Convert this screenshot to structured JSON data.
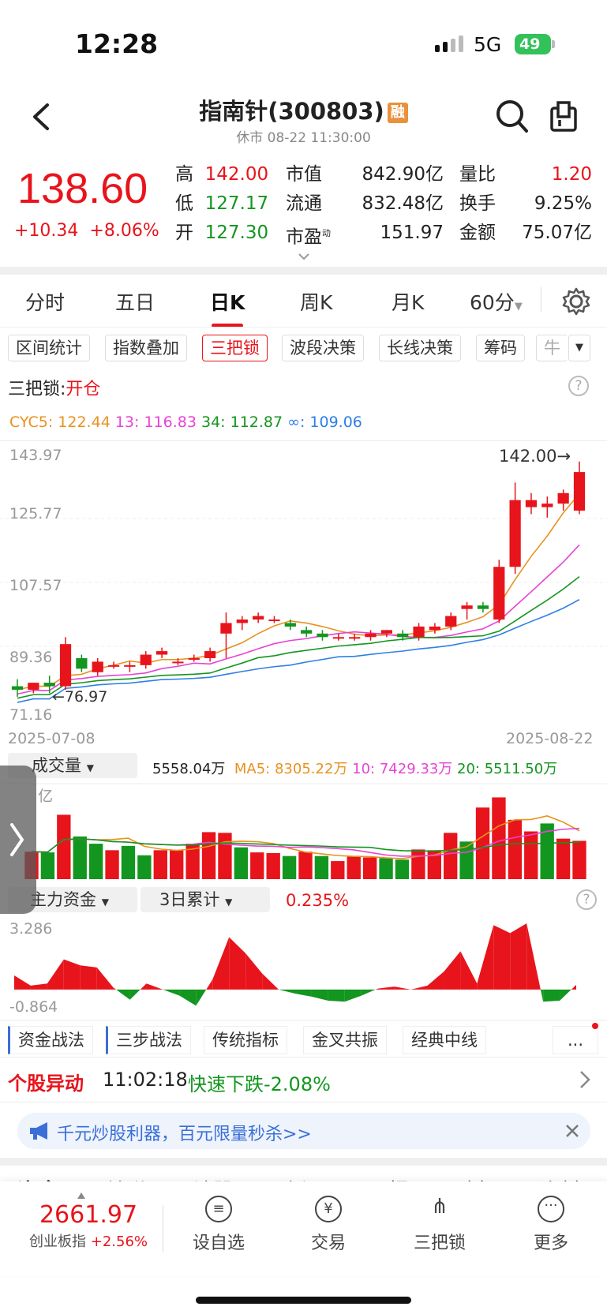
{
  "status_bar": {
    "time": "12:28",
    "network": "5G",
    "battery": "49"
  },
  "header": {
    "title": "指南针(300803)",
    "badge": "融",
    "subtitle": "休市 08-22 11:30:00"
  },
  "quote": {
    "price": "138.60",
    "change": "+10.34",
    "change_pct": "+8.06%",
    "grid": [
      {
        "label": "高",
        "value": "142.00",
        "color": "red"
      },
      {
        "label": "低",
        "value": "127.17",
        "color": "green"
      },
      {
        "label": "开",
        "value": "127.30",
        "color": "green"
      },
      {
        "label": "市值",
        "value": "842.90亿"
      },
      {
        "label": "流通",
        "value": "832.48亿"
      },
      {
        "label": "市盈",
        "sup": "动",
        "value": "151.97"
      },
      {
        "label": "量比",
        "value": "1.20",
        "color": "red"
      },
      {
        "label": "换手",
        "value": "9.25%"
      },
      {
        "label": "金额",
        "value": "75.07亿"
      }
    ]
  },
  "tabs": [
    "分时",
    "五日",
    "日K",
    "周K",
    "月K",
    "60分"
  ],
  "active_tab": "日K",
  "chips": [
    "区间统计",
    "指数叠加",
    "三把锁",
    "波段决策",
    "长线决策",
    "筹码",
    "牛"
  ],
  "selected_chip": "三把锁",
  "signal": {
    "label": "三把锁:",
    "value": "开仓"
  },
  "ma_legend": [
    {
      "text": "CYC5: 122.44",
      "color": "#e8921f"
    },
    {
      "text": "13: 116.83",
      "color": "#e843d4"
    },
    {
      "text": "34: 112.87",
      "color": "#13961f"
    },
    {
      "text": "∞: 109.06",
      "color": "#2f7fe6"
    }
  ],
  "price_axis": [
    "143.97",
    "125.77",
    "107.57",
    "89.36",
    "71.16"
  ],
  "annotations": {
    "high": "142.00→",
    "low": "←76.97"
  },
  "dates": {
    "start": "2025-07-08",
    "end": "2025-08-22"
  },
  "volume": {
    "selector": "成交量",
    "value": "5558.04万",
    "ma5": "MA5: 8305.22万",
    "ma10": "10: 7429.33万",
    "ma20": "20: 5511.50万",
    "axis": "亿"
  },
  "capital": {
    "selector": "主力资金",
    "period": "3日累计",
    "value": "0.235%",
    "max": "3.286",
    "min": "-0.864"
  },
  "bottom_tabs": [
    "资金战法",
    "三步战法",
    "传统指标",
    "金叉共振",
    "经典中线",
    "..."
  ],
  "alert": {
    "title": "个股异动",
    "time": "11:02:18",
    "text": "快速下跌-2.08%"
  },
  "banner": {
    "text": "千元炒股利器，百元限量秒杀>>"
  },
  "section_tabs": [
    "资金",
    "关联",
    "诊股",
    "资讯",
    "研报",
    "财务",
    "资料"
  ],
  "nav": {
    "index_value": "2661.97",
    "index_name": "创业板指",
    "index_change": "+2.56%",
    "items": [
      {
        "label": "设自选",
        "icon": "menu-icon"
      },
      {
        "label": "交易",
        "icon": "yen-icon"
      },
      {
        "label": "三把锁",
        "icon": "lock-tree-icon"
      },
      {
        "label": "更多",
        "icon": "more-icon"
      }
    ]
  },
  "chart_data": [
    {
      "type": "candlestick",
      "title": "日K",
      "ylim": [
        71.16,
        143.97
      ],
      "x_range": [
        "2025-07-08",
        "2025-08-22"
      ],
      "ohlc": [
        [
          78,
          80,
          75,
          77
        ],
        [
          77,
          79,
          76,
          79
        ],
        [
          79,
          81,
          76,
          78
        ],
        [
          78,
          92,
          77,
          90
        ],
        [
          86,
          87,
          82,
          83
        ],
        [
          82,
          86,
          81,
          85
        ],
        [
          84,
          85,
          83,
          84
        ],
        [
          84,
          85,
          82,
          84
        ],
        [
          84,
          88,
          83,
          87
        ],
        [
          87,
          89,
          86,
          88
        ],
        [
          85,
          86,
          84,
          85
        ],
        [
          86,
          87,
          85,
          86
        ],
        [
          86,
          89,
          85,
          88
        ],
        [
          93,
          99,
          86,
          96
        ],
        [
          96,
          98,
          94,
          97
        ],
        [
          97,
          99,
          96,
          98
        ],
        [
          97,
          98,
          96,
          97
        ],
        [
          96,
          97,
          94,
          95
        ],
        [
          94,
          95,
          92,
          93
        ],
        [
          93,
          94,
          91,
          92
        ],
        [
          92,
          93,
          91,
          92
        ],
        [
          92,
          93,
          91,
          92
        ],
        [
          92,
          94,
          91,
          93
        ],
        [
          93,
          94,
          92,
          94
        ],
        [
          93,
          94,
          91,
          92
        ],
        [
          92,
          96,
          91,
          95
        ],
        [
          94,
          96,
          93,
          95
        ],
        [
          95,
          99,
          94,
          98
        ],
        [
          100,
          102,
          97,
          101
        ],
        [
          101,
          102,
          99,
          100
        ],
        [
          97,
          114,
          96,
          112
        ],
        [
          112,
          136,
          110,
          131
        ],
        [
          129,
          133,
          127,
          131
        ],
        [
          129,
          132,
          126,
          130
        ],
        [
          130,
          134,
          128,
          133
        ],
        [
          128,
          142,
          127,
          139
        ]
      ]
    },
    {
      "type": "bar",
      "title": "成交量",
      "unit": "亿",
      "values": [
        0.38,
        0.37,
        0.89,
        0.59,
        0.49,
        0.4,
        0.46,
        0.33,
        0.4,
        0.4,
        0.49,
        0.65,
        0.64,
        0.44,
        0.37,
        0.36,
        0.32,
        0.38,
        0.32,
        0.25,
        0.31,
        0.3,
        0.29,
        0.27,
        0.41,
        0.4,
        0.64,
        0.52,
        0.99,
        1.13,
        0.82,
        0.66,
        0.77,
        0.56,
        0.53
      ],
      "up": [
        1,
        0,
        1,
        0,
        0,
        1,
        0,
        0,
        1,
        1,
        1,
        1,
        1,
        0,
        1,
        1,
        0,
        1,
        0,
        1,
        1,
        1,
        0,
        0,
        1,
        1,
        1,
        0,
        1,
        1,
        1,
        1,
        0,
        1,
        1
      ]
    },
    {
      "type": "area",
      "title": "主力资金",
      "ylim": [
        -0.864,
        3.286
      ],
      "values": [
        0.7,
        0.2,
        0.3,
        1.5,
        1.2,
        1.1,
        0.1,
        -0.5,
        0.3,
        0.0,
        -0.3,
        -0.8,
        0.5,
        2.6,
        1.8,
        0.8,
        0.0,
        -0.2,
        -0.35,
        -0.55,
        -0.6,
        -0.3,
        0.05,
        0.15,
        0.0,
        0.2,
        0.9,
        1.9,
        0.3,
        3.2,
        2.8,
        3.286,
        -0.6,
        -0.55,
        0.235
      ]
    }
  ]
}
